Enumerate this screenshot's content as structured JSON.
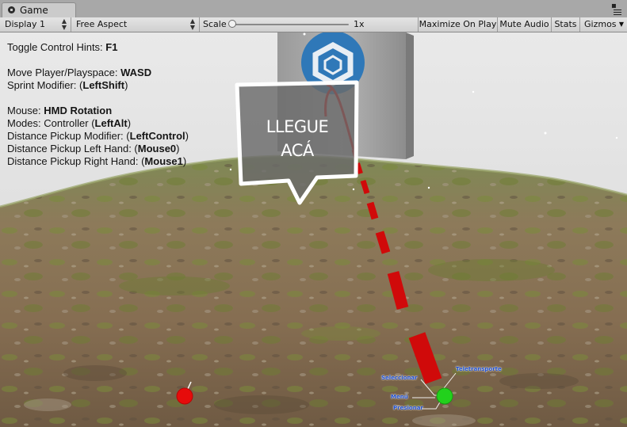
{
  "window": {
    "tab_title": "Game"
  },
  "toolbar": {
    "display": "Display 1",
    "aspect": "Free Aspect",
    "scale_label": "Scale",
    "scale_value": "1x",
    "maximize_on_play": "Maximize On Play",
    "mute_audio": "Mute Audio",
    "stats": "Stats",
    "gizmos": "Gizmos"
  },
  "hints": [
    {
      "label": "Toggle Control Hints: ",
      "key": "F1",
      "suffix": ""
    },
    null,
    {
      "label": "Move Player/Playspace: ",
      "key": "WASD",
      "suffix": ""
    },
    {
      "label": "Sprint Modifier: (",
      "key": "LeftShift",
      "suffix": ")"
    },
    null,
    {
      "label": "Mouse: ",
      "key": "HMD Rotation",
      "suffix": ""
    },
    {
      "label": "Modes: Controller (",
      "key": "LeftAlt",
      "suffix": ")"
    },
    {
      "label": "Distance Pickup Modifier: (",
      "key": "LeftControl",
      "suffix": ")"
    },
    {
      "label": "Distance Pickup Left Hand: (",
      "key": "Mouse0",
      "suffix": ")"
    },
    {
      "label": "Distance Pickup Right Hand: (",
      "key": "Mouse1",
      "suffix": ")"
    }
  ],
  "speech_bubble": {
    "line1": "LLEGUE",
    "line2": "ACÁ"
  },
  "controller_hints": {
    "top_left": "Seleccionar",
    "top_right": "Teletransporte",
    "middle": "Menú",
    "bottom": "Presionar"
  },
  "colors": {
    "teleport_arc": "#d00a0a",
    "left_controller": "#e60b0b",
    "right_controller": "#22d11c",
    "hint_label": "#1f4fcf",
    "terrain_base": "#8a7558",
    "sky": "#e3e3e3"
  },
  "icons": {
    "tab": "unity-logo-icon",
    "panel_menu": "hamburger-menu-icon",
    "billboard": "cube-logo-icon"
  }
}
